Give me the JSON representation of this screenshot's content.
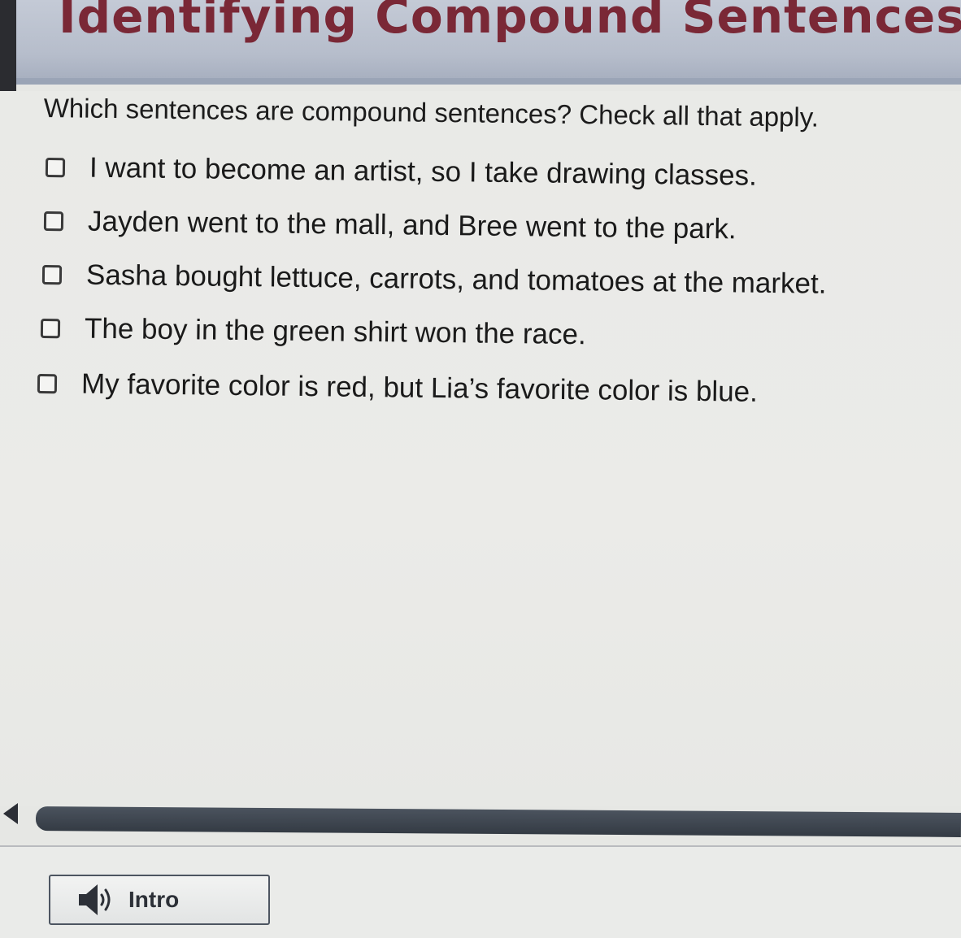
{
  "header": {
    "title": "Identifying Compound Sentences"
  },
  "question": {
    "prompt": "Which sentences are compound sentences? Check all that apply."
  },
  "options": [
    {
      "label": "I want to become an artist, so I take drawing classes.",
      "checked": false
    },
    {
      "label": "Jayden went to the mall, and Bree went to the park.",
      "checked": false
    },
    {
      "label": "Sasha bought lettuce, carrots, and tomatoes at the market.",
      "checked": false
    },
    {
      "label": "The boy in the green shirt won the race.",
      "checked": false
    },
    {
      "label": "My favorite color is red, but Lia’s favorite color is blue.",
      "checked": false
    }
  ],
  "footer": {
    "intro_label": "Intro",
    "intro_icon": "speaker-icon"
  },
  "colors": {
    "title": "#7a2836",
    "header_bg": "#b6bdcb",
    "scrollbar": "#343b44"
  }
}
